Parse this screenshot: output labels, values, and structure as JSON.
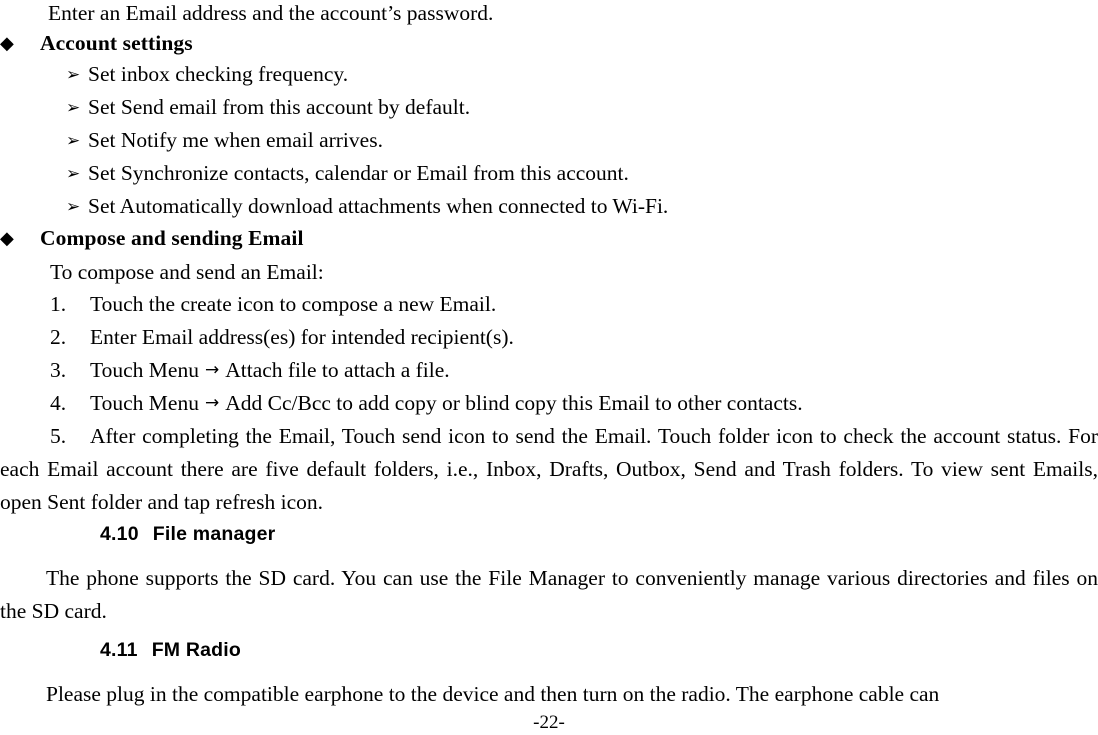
{
  "document": {
    "intro_line": "Enter an Email address and the account’s password.",
    "bullet_glyph": "◆",
    "arrow_bullet_glyph": "➢",
    "menu_arrow_glyph": "→",
    "sections": {
      "account_settings": {
        "heading": "Account settings",
        "items": [
          "Set inbox checking frequency.",
          "Set Send email from this account by default.",
          "Set Notify me when email arrives.",
          "Set Synchronize contacts, calendar or Email from this account.",
          "Set Automatically download attachments when connected to Wi-Fi."
        ]
      },
      "compose_email": {
        "heading": "Compose and sending Email",
        "lead_in": "To compose and send an Email:",
        "steps": [
          {
            "number": "1.",
            "text": "Touch the create icon to compose a new Email."
          },
          {
            "number": "2.",
            "text": "Enter Email address(es) for intended recipient(s)."
          },
          {
            "number": "3.",
            "text_before_arrow": "Touch Menu",
            "text_after_arrow": "Attach file to attach a file."
          },
          {
            "number": "4.",
            "text_before_arrow": "Touch Menu",
            "text_after_arrow": "Add Cc/Bcc to add copy or blind copy this Email to other contacts."
          },
          {
            "number": "5.",
            "text": "After completing the Email, Touch send icon to send the Email. Touch folder icon to check the account status. For each Email account there are five default folders, i.e., Inbox, Drafts, Outbox, Send and Trash folders. To view sent Emails, open Sent folder and tap refresh icon."
          }
        ]
      },
      "file_manager": {
        "number": "4.10",
        "title": "File manager",
        "body": "The phone supports the SD card. You can use the File Manager to conveniently manage various directories and files on the SD card."
      },
      "fm_radio": {
        "number": "4.11",
        "title": "FM Radio",
        "body": "Please plug in the compatible earphone to the device and then turn on the radio. The earphone cable can"
      }
    },
    "page_number": "-22-"
  }
}
